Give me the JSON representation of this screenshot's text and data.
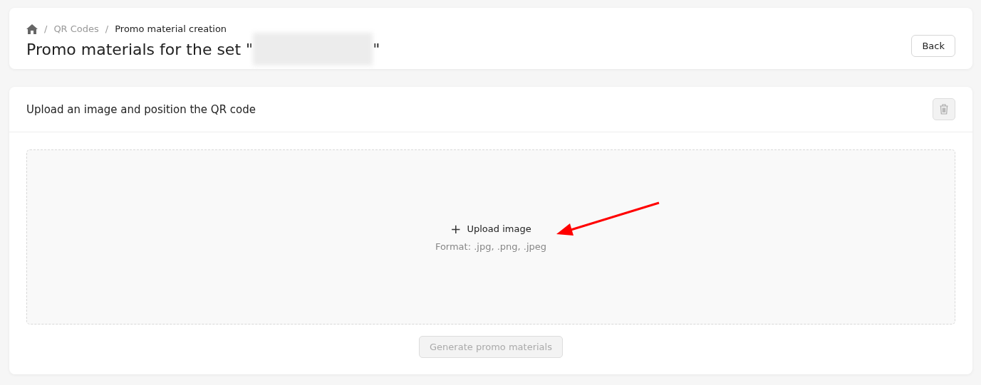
{
  "breadcrumb_separator": "/",
  "breadcrumbs": [
    {
      "kind": "home"
    },
    {
      "kind": "link",
      "label": "QR Codes"
    },
    {
      "kind": "current",
      "label": "Promo material creation"
    }
  ],
  "header": {
    "title": "Promo materials for the set \"",
    "title_end": "\"",
    "redacted": true,
    "back_button": "Back"
  },
  "upload_card": {
    "title": "Upload an image and position the QR code",
    "delete_disabled": true,
    "dropzone": {
      "icon": "+",
      "label": "Upload image",
      "hint": "Format: .jpg, .png, .jpeg"
    },
    "generate_button": {
      "label": "Generate promo materials",
      "disabled": true
    }
  },
  "annotation": {
    "kind": "arrow"
  }
}
